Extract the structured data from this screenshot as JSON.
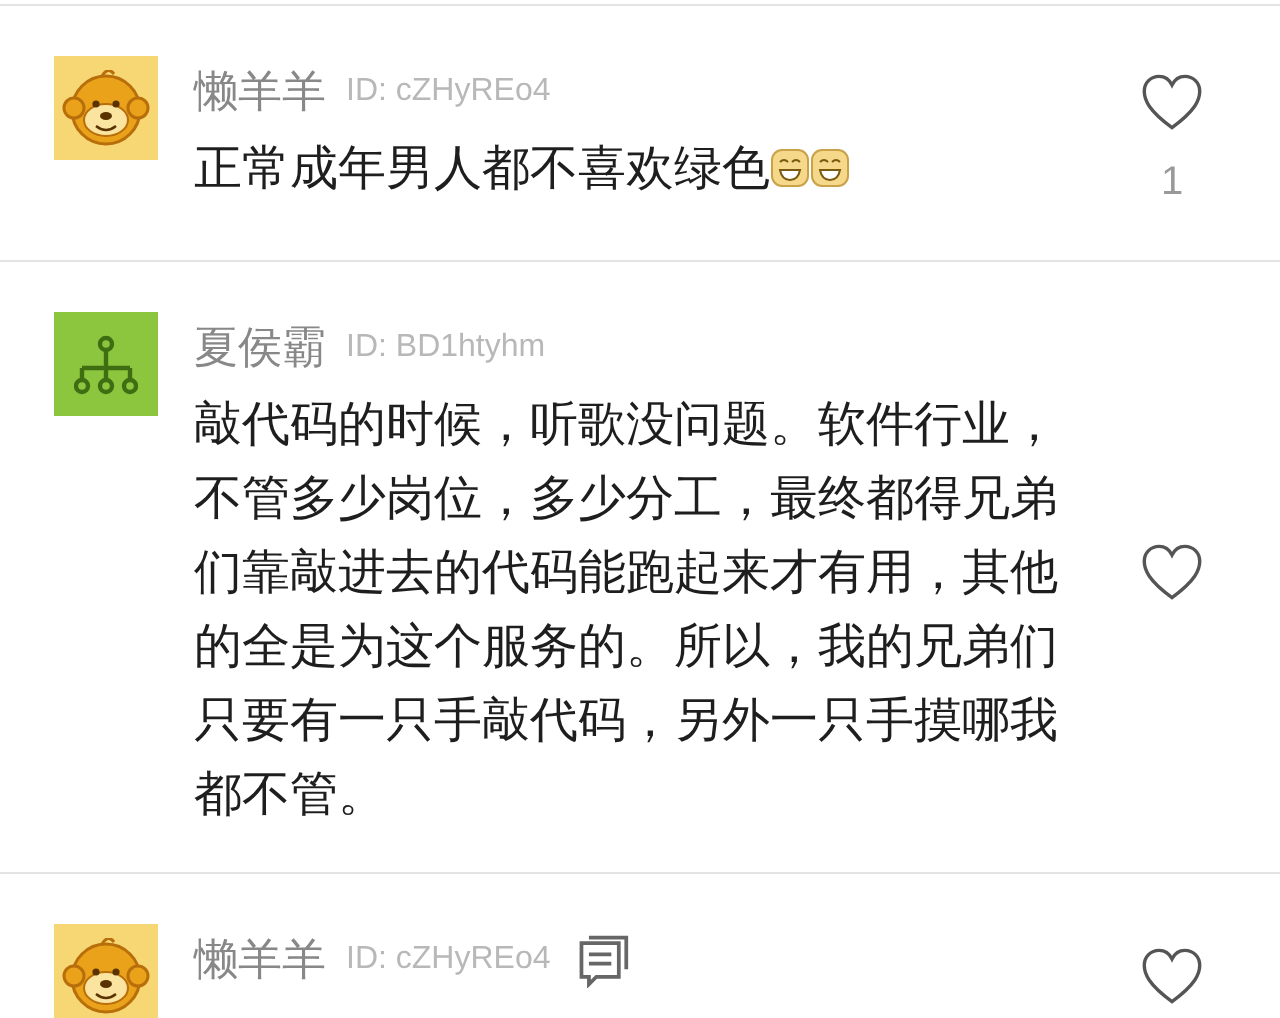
{
  "comments": [
    {
      "avatar": {
        "kind": "monkey",
        "color": "#f7d774"
      },
      "name": "懒羊羊",
      "user_id": "ID: cZHyREo4",
      "has_replies": false,
      "text": "正常成年男人都不喜欢绿色",
      "emoji": [
        {
          "kind": "grin"
        },
        {
          "kind": "grin"
        }
      ],
      "like_count": "1"
    },
    {
      "avatar": {
        "kind": "tree",
        "color": "#8cc63f"
      },
      "name": "夏侯霸",
      "user_id": "ID: BD1htyhm",
      "has_replies": false,
      "text": "敲代码的时候，听歌没问题。软件行业，不管多少岗位，多少分工，最终都得兄弟们靠敲进去的代码能跑起来才有用，其他的全是为这个服务的。所以，我的兄弟们只要有一只手敲代码，另外一只手摸哪我都不管。"
    },
    {
      "avatar": {
        "kind": "monkey",
        "color": "#f7d774"
      },
      "name": "懒羊羊",
      "user_id": "ID: cZHyREo4",
      "has_replies": true
    }
  ]
}
